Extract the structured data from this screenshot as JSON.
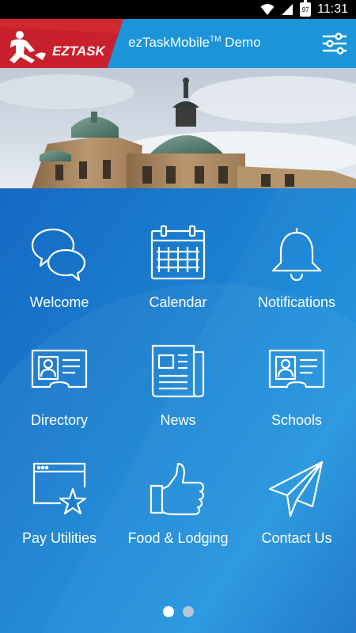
{
  "status_bar": {
    "battery": "97",
    "time": "11:31"
  },
  "header": {
    "logo_text": "EZTASK",
    "title": "ezTaskMobile",
    "title_superscript": "TM",
    "title_suffix": " Demo"
  },
  "tiles": [
    {
      "label": "Welcome",
      "icon": "chat-bubbles-icon"
    },
    {
      "label": "Calendar",
      "icon": "calendar-icon"
    },
    {
      "label": "Notifications",
      "icon": "bell-icon"
    },
    {
      "label": "Directory",
      "icon": "id-card-icon"
    },
    {
      "label": "News",
      "icon": "newspaper-icon"
    },
    {
      "label": "Schools",
      "icon": "id-card-icon"
    },
    {
      "label": "Pay Utilities",
      "icon": "browser-star-icon"
    },
    {
      "label": "Food & Lodging",
      "icon": "thumbs-up-icon"
    },
    {
      "label": "Contact Us",
      "icon": "paper-plane-icon"
    }
  ],
  "pager": {
    "pages": 2,
    "current": 1
  },
  "colors": {
    "app_bar": "#1b94da",
    "logo_red": "#c8202c",
    "background": "#1172c6"
  }
}
